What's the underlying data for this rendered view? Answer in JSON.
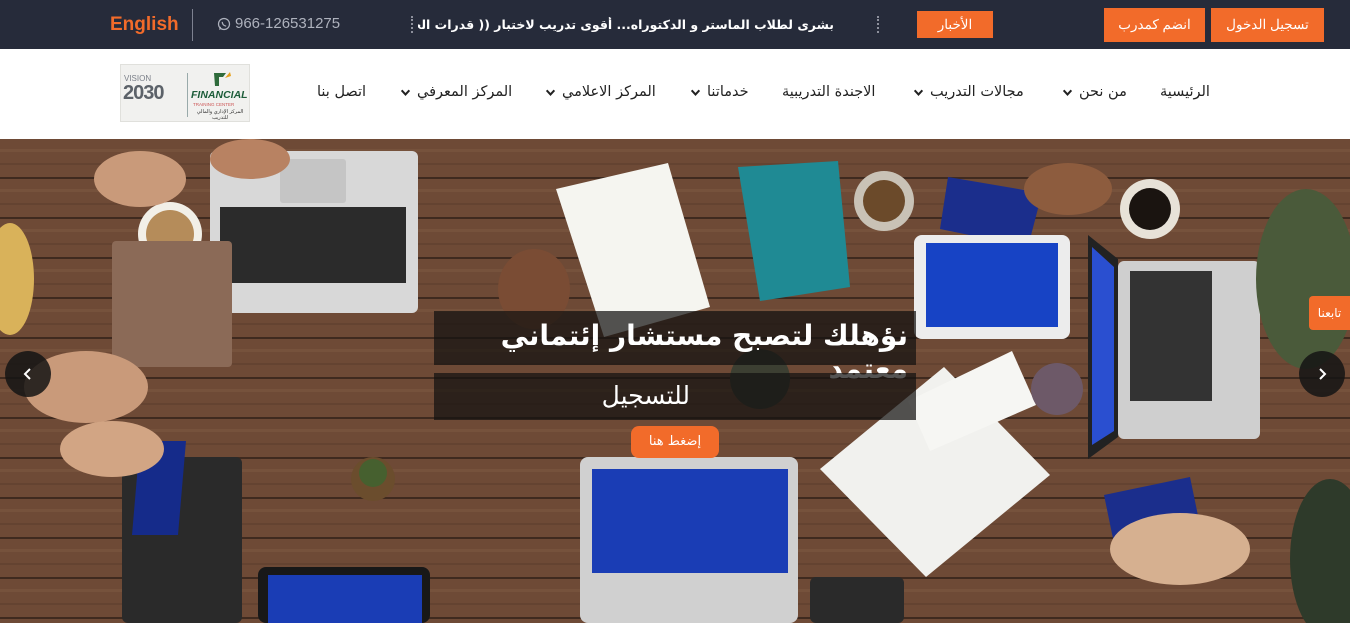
{
  "topbar": {
    "language": "English",
    "phone": "966-126531275",
    "ticker": "بشرى لطلاب الماستر و الدكتوراه... أقوى تدريب لاختبار (( قدرات الجامعيين))",
    "news_label": "الأخبار",
    "join_trainer_label": "انضم كمدرب",
    "login_label": "تسجيل الدخول"
  },
  "logo": {
    "vision": "VISION",
    "year": "2030",
    "brand": "FINANCIAL",
    "brand_sub": "TRAINING CENTER",
    "brand_ar": "المركز الإداري والمالي للتدريب"
  },
  "nav": {
    "home": "الرئيسية",
    "about": "من نحن",
    "training_fields": "مجالات التدريب",
    "agenda": "الاجندة التدريبية",
    "services": "خدماتنا",
    "media": "المركز الاعلامي",
    "knowledge": "المركز المعرفي",
    "contact": "اتصل بنا"
  },
  "hero": {
    "headline": "نؤهلك لتصبح مستشار إئتماني معتمد",
    "subline": "للتسجيل",
    "cta": "إضغط هنا",
    "follow": "تابعنا"
  },
  "colors": {
    "accent": "#f26b2a",
    "topbar_bg": "#262b3a"
  }
}
